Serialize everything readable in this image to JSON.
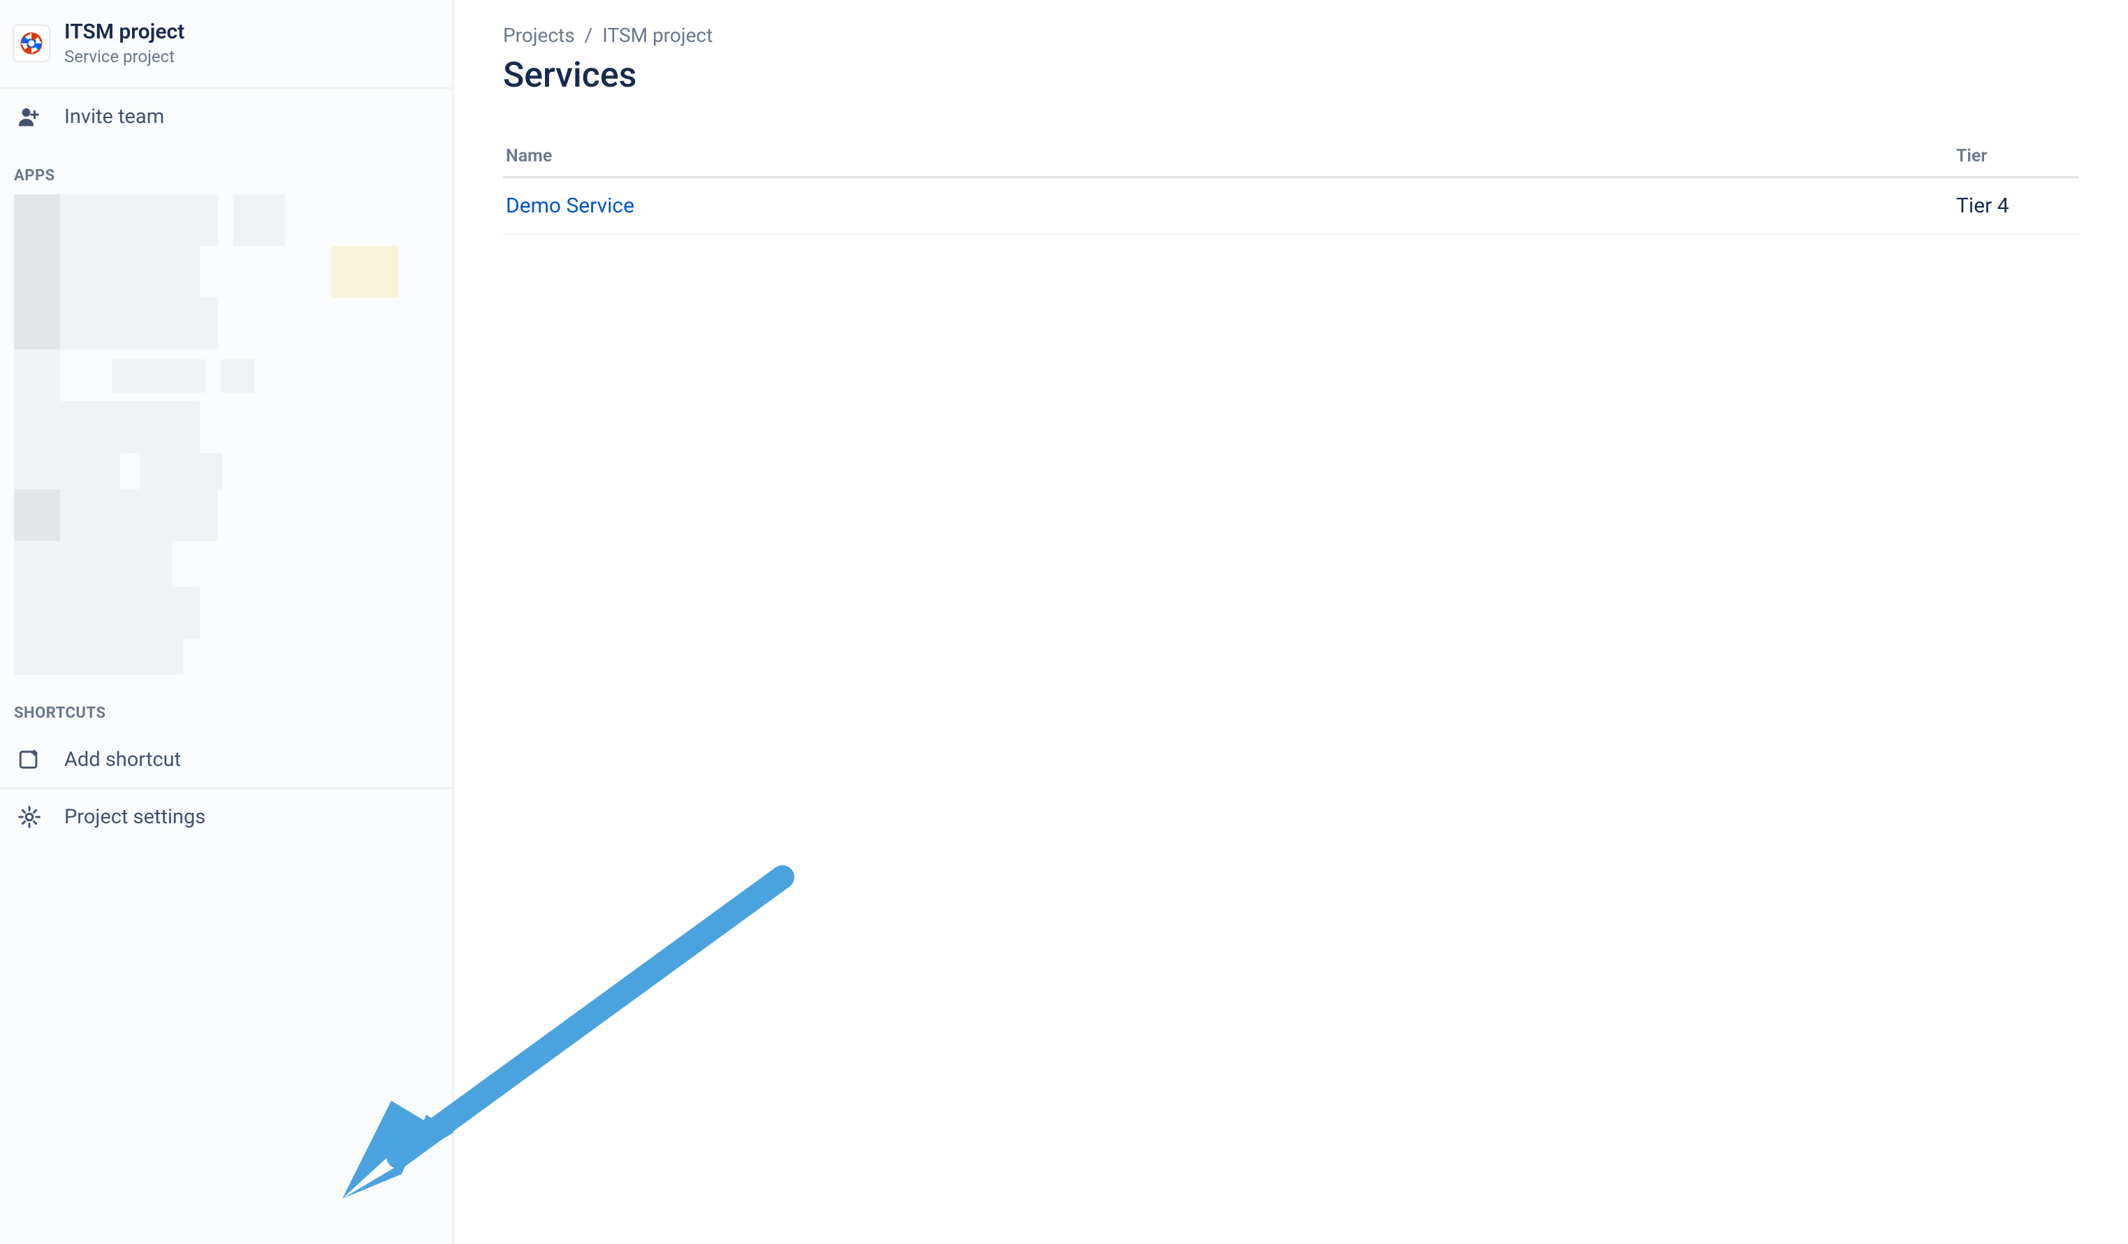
{
  "sidebar": {
    "project_title": "ITSM project",
    "project_subtitle": "Service project",
    "invite_team_label": "Invite team",
    "apps_section_label": "APPS",
    "shortcuts_section_label": "SHORTCUTS",
    "add_shortcut_label": "Add shortcut",
    "project_settings_label": "Project settings"
  },
  "breadcrumb": {
    "projects_label": "Projects",
    "current_label": "ITSM project",
    "separator": "/"
  },
  "page": {
    "title": "Services"
  },
  "table": {
    "columns": {
      "name": "Name",
      "tier": "Tier"
    },
    "rows": [
      {
        "name": "Demo Service",
        "tier": "Tier 4"
      }
    ]
  }
}
